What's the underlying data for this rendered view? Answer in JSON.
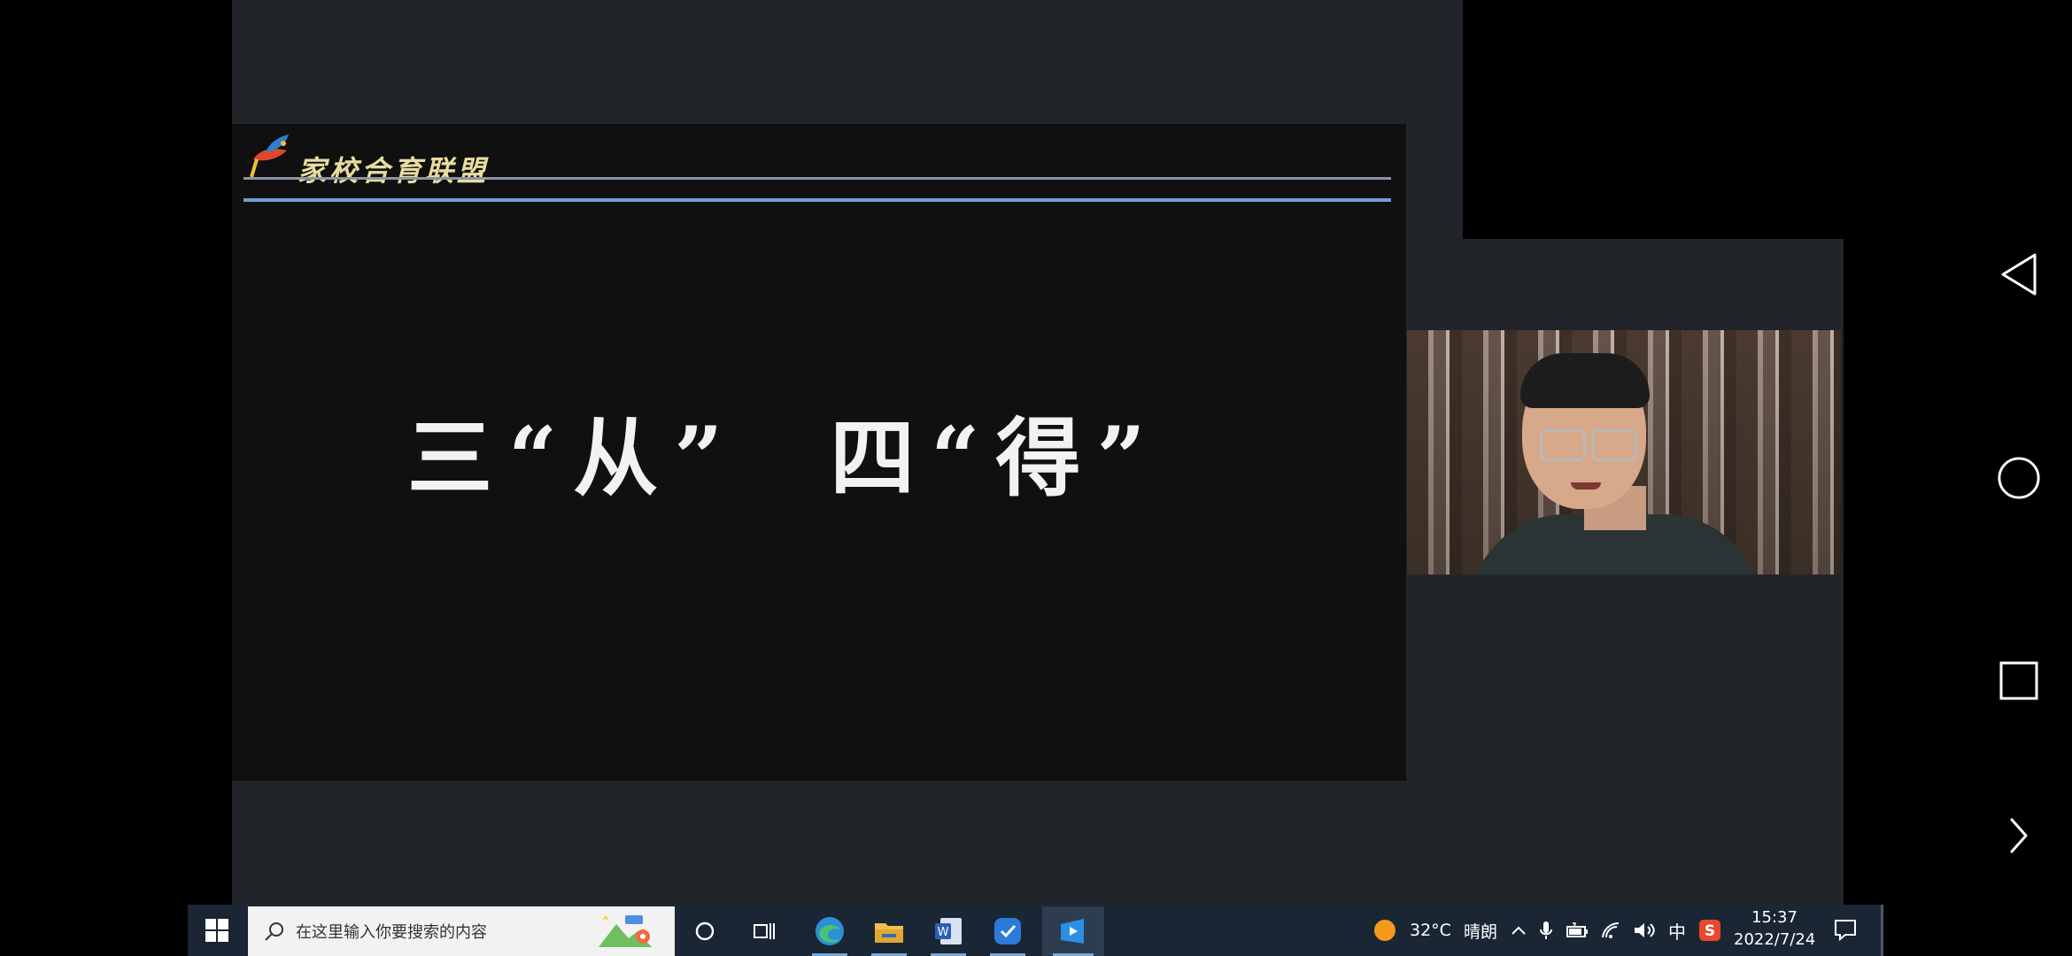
{
  "slide": {
    "brand": "家校合育联盟",
    "title": "三“从”  四“得”"
  },
  "taskbar": {
    "search_placeholder": "在这里输入你要搜索的内容",
    "weather_temp": "32°C",
    "weather_desc": "晴朗",
    "ime": "中",
    "time": "15:37",
    "date": "2022/7/24"
  },
  "icons": {
    "start": "windows-start-icon",
    "search": "search-icon",
    "cortana": "cortana-icon",
    "task_view": "task-view-icon",
    "edge": "edge-browser-icon",
    "explorer": "file-explorer-icon",
    "word": "word-icon",
    "app1": "blue-app-icon",
    "app2": "meeting-app-icon"
  },
  "colors": {
    "taskbar": "#1a2634",
    "panel": "#21252a",
    "slide_bg": "#101010",
    "accent_line": "#6f9fd6"
  }
}
